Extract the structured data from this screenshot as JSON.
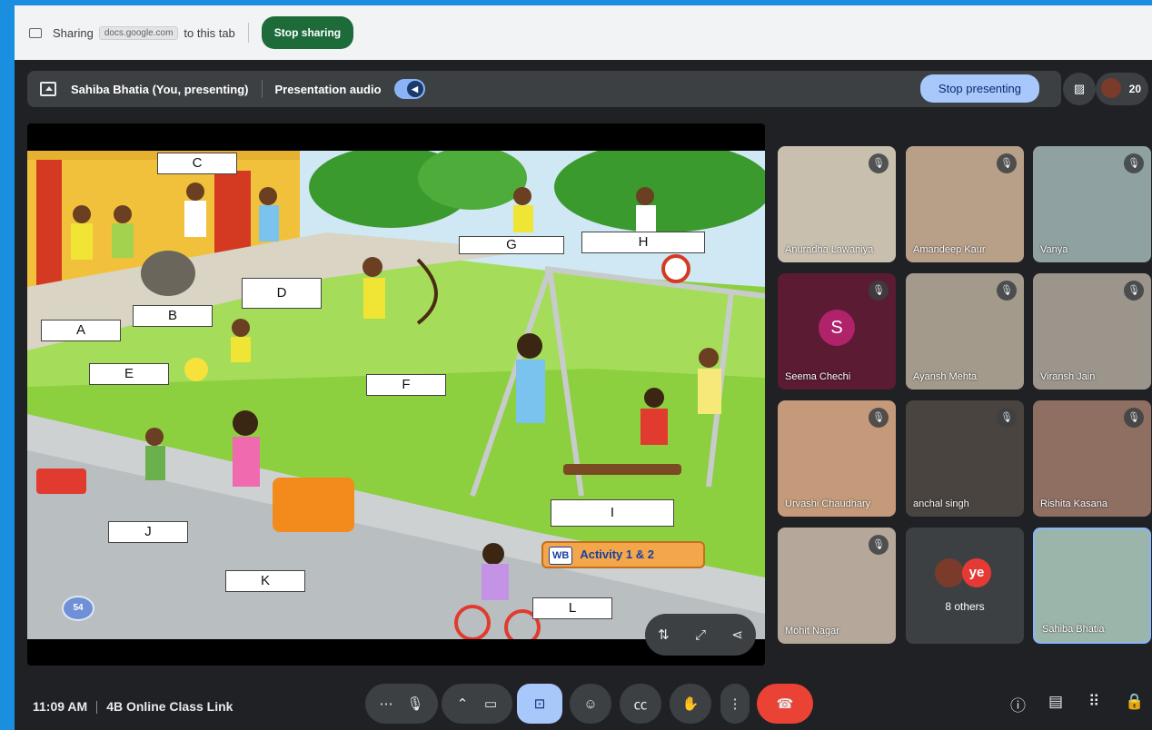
{
  "share_bar": {
    "sharing_prefix": "Sharing",
    "domain_chip": "docs.google.com",
    "sharing_suffix": "to this tab",
    "stop_sharing_label": "Stop sharing"
  },
  "presenter_bar": {
    "presenter_name": "Sahiba Bhatia (You, presenting)",
    "presentation_audio_label": "Presentation audio",
    "stop_presenting_label": "Stop presenting",
    "participant_count": "20"
  },
  "slide": {
    "labels": [
      "C",
      "G",
      "H",
      "D",
      "B",
      "A",
      "E",
      "F",
      "I",
      "J",
      "K",
      "L"
    ],
    "page_number": "54",
    "badge_prefix": "WB",
    "badge_text": "Activity 1 & 2"
  },
  "participants": [
    {
      "name": "Anuradha Lawaniya"
    },
    {
      "name": "Amandeep Kaur"
    },
    {
      "name": "Vanya"
    },
    {
      "name": "Seema Chechi",
      "initial": "S"
    },
    {
      "name": "Ayansh Mehta"
    },
    {
      "name": "Viransh Jain"
    },
    {
      "name": "Urvashi Chaudhary"
    },
    {
      "name": "anchal singh"
    },
    {
      "name": "Rishita Kasana"
    },
    {
      "name": "Mohit Nagar"
    },
    {
      "name": "8 others"
    },
    {
      "name": "Sahiba Bhatia"
    }
  ],
  "bottom_bar": {
    "time": "11:09 AM",
    "meeting_name": "4B Online Class Link"
  },
  "colors": {
    "share_green": "#1e6b3a",
    "stop_presenting_bg": "#a8c7fa",
    "leave_red": "#ea4335",
    "present_active": "#a8c7fa"
  }
}
